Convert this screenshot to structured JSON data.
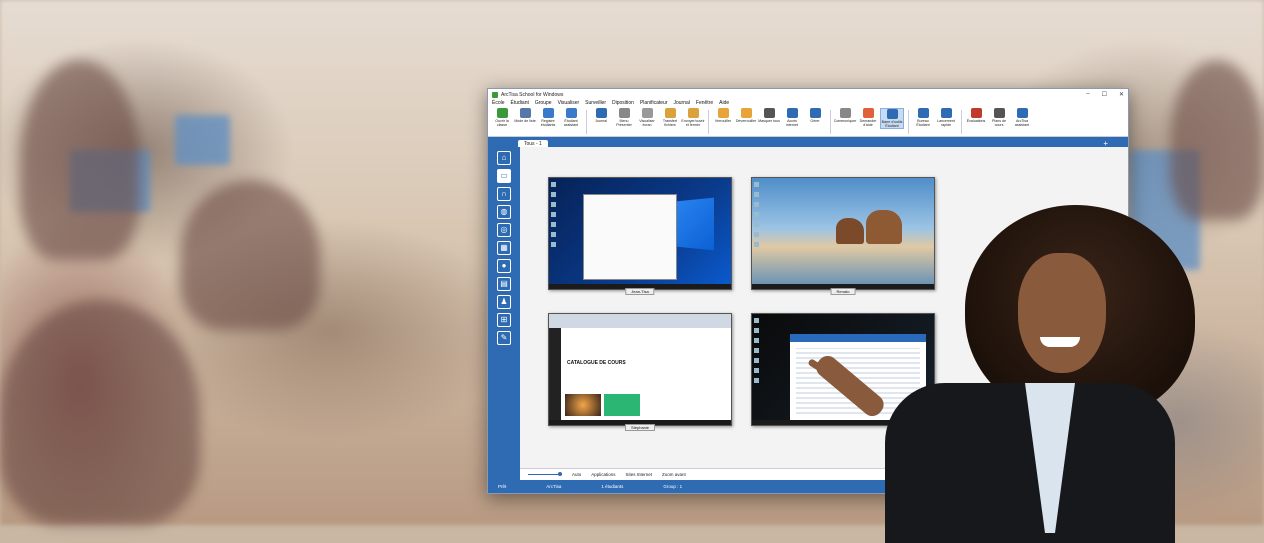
{
  "window": {
    "title": "ArcTisa School for Windows",
    "controls": [
      "–",
      "☐",
      "✕"
    ]
  },
  "menu": [
    "École",
    "Étudiant",
    "Groupe",
    "Visualiser",
    "Surveiller",
    "Diposition",
    "Planificateur",
    "Journal",
    "Fenêtre",
    "Aide"
  ],
  "ribbon": [
    {
      "label": "Ouvrir la classe",
      "icon": "open-class-icon",
      "color": "#3a9a3a"
    },
    {
      "label": "Mode de liste",
      "icon": "list-mode-icon",
      "color": "#5577aa"
    },
    {
      "label": "Registre étudiants",
      "icon": "register-icon",
      "color": "#3a7ac7"
    },
    {
      "label": "Étudiant assistant",
      "icon": "assistant-icon",
      "color": "#3a7ac7"
    },
    {
      "label": "Journal",
      "icon": "journal-icon",
      "color": "#2f6bb3"
    },
    {
      "label": "Menu Présenter",
      "icon": "present-icon",
      "color": "#888"
    },
    {
      "label": "Visualiser écran",
      "icon": "view-screen-icon",
      "color": "#999"
    },
    {
      "label": "Transfert fichiers",
      "icon": "transfer-icon",
      "color": "#d9a23a"
    },
    {
      "label": "Envoyer/ouvrir et fermer",
      "icon": "send-icon",
      "color": "#d9a23a"
    },
    {
      "label": "Verrouiller",
      "icon": "lock-icon",
      "color": "#e8a33a"
    },
    {
      "label": "Déverrouiller",
      "icon": "unlock-icon",
      "color": "#e8a33a"
    },
    {
      "label": "Masquer tous",
      "icon": "hide-icon",
      "color": "#555"
    },
    {
      "label": "Accès internet",
      "icon": "globe-icon",
      "color": "#2f6bb3"
    },
    {
      "label": "Gérer",
      "icon": "manage-icon",
      "color": "#2f6bb3"
    },
    {
      "label": "Communiquer",
      "icon": "chat-icon",
      "color": "#888"
    },
    {
      "label": "Demander d'aide",
      "icon": "help-icon",
      "color": "#e0603a"
    },
    {
      "label": "Barre d'outils Étudiant",
      "icon": "toolbar-icon",
      "color": "#2f6bb3",
      "active": true
    },
    {
      "label": "Bureau Étudiant",
      "icon": "desktop-icon",
      "color": "#2f6bb3"
    },
    {
      "label": "Lancement rapide",
      "icon": "launch-icon",
      "color": "#2f6bb3"
    },
    {
      "label": "Évaluations",
      "icon": "evaluation-icon",
      "color": "#c0392b"
    },
    {
      "label": "Plans de cours",
      "icon": "lessons-icon",
      "color": "#555"
    },
    {
      "label": "ArcTisa assistant",
      "icon": "ai-icon",
      "color": "#2f6bb3"
    }
  ],
  "tab": {
    "label": "Tous - 1"
  },
  "sidebar": [
    "home-icon",
    "monitor-icon",
    "headset-icon",
    "chat-icon",
    "globe-icon",
    "grid-icon",
    "circle-icon",
    "printer-icon",
    "users-icon",
    "group-icon",
    "edit-icon"
  ],
  "thumbnails": [
    {
      "name": "Jean-Tisa"
    },
    {
      "name": "Renato"
    },
    {
      "name": "Stéphanie",
      "page_title": "CATALOGUE DE COURS"
    },
    {
      "name": ""
    }
  ],
  "statusbar": {
    "auto": "Auto",
    "applications": "Applications",
    "sites": "Sites Internet",
    "zoom": "Zoom avant"
  },
  "bottombar": {
    "left": "Prêt",
    "brand": "ArcTisa",
    "students": "1 étudiants",
    "group": "Group : 1"
  }
}
